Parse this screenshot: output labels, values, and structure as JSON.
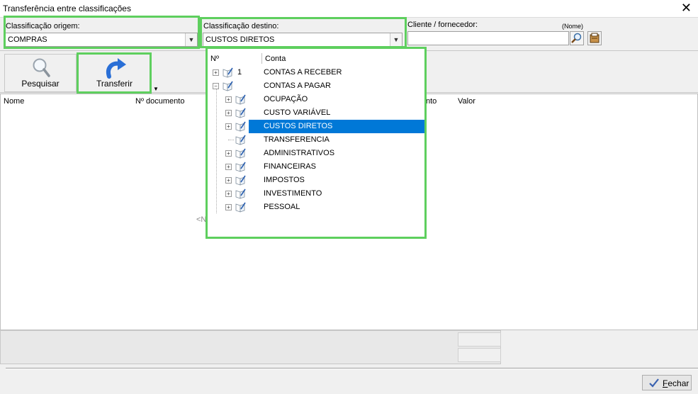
{
  "window": {
    "title": "Transferência entre classificações",
    "close_glyph": "✕"
  },
  "filters": {
    "origem_label": "Classificação origem:",
    "origem_value": "COMPRAS",
    "destino_label": "Classificação destino:",
    "destino_value": "CUSTOS DIRETOS",
    "cliente_label": "Cliente / fornecedor:",
    "cliente_hint": "(Nome)",
    "cliente_value": "",
    "combo_arrow": "▼"
  },
  "toolbar": {
    "search_label": "Pesquisar",
    "transfer_label": "Transferir",
    "dropdown_arrow": "▼"
  },
  "grid": {
    "columns": [
      "Nome",
      "Nº documento",
      "nto",
      "Valor"
    ],
    "empty_partial": "<N"
  },
  "popup": {
    "col_num": "Nº",
    "col_conta": "Conta",
    "items": [
      {
        "num": "1",
        "label": "CONTAS A RECEBER",
        "level": 0,
        "expander": "+",
        "selected": false
      },
      {
        "num": "",
        "label": "CONTAS A PAGAR",
        "level": 0,
        "expander": "−",
        "selected": false
      },
      {
        "num": "",
        "label": "OCUPAÇÃO",
        "level": 1,
        "expander": "+",
        "selected": false
      },
      {
        "num": "",
        "label": "CUSTO VARIÁVEL",
        "level": 1,
        "expander": "+",
        "selected": false
      },
      {
        "num": "",
        "label": "CUSTOS DIRETOS",
        "level": 1,
        "expander": "+",
        "selected": true
      },
      {
        "num": "",
        "label": "TRANSFERENCIA",
        "level": 1,
        "expander": "",
        "selected": false
      },
      {
        "num": "",
        "label": "ADMINISTRATIVOS",
        "level": 1,
        "expander": "+",
        "selected": false
      },
      {
        "num": "",
        "label": "FINANCEIRAS",
        "level": 1,
        "expander": "+",
        "selected": false
      },
      {
        "num": "",
        "label": "IMPOSTOS",
        "level": 1,
        "expander": "+",
        "selected": false
      },
      {
        "num": "",
        "label": "INVESTIMENTO",
        "level": 1,
        "expander": "+",
        "selected": false
      },
      {
        "num": "",
        "label": "PESSOAL",
        "level": 1,
        "expander": "+",
        "selected": false
      }
    ]
  },
  "footer": {
    "close_label_underlined": "F",
    "close_label_rest": "echar"
  },
  "colors": {
    "highlight": "#5ecf5e",
    "selection": "#0078d7",
    "transfer_icon": "#2a6fd6"
  }
}
